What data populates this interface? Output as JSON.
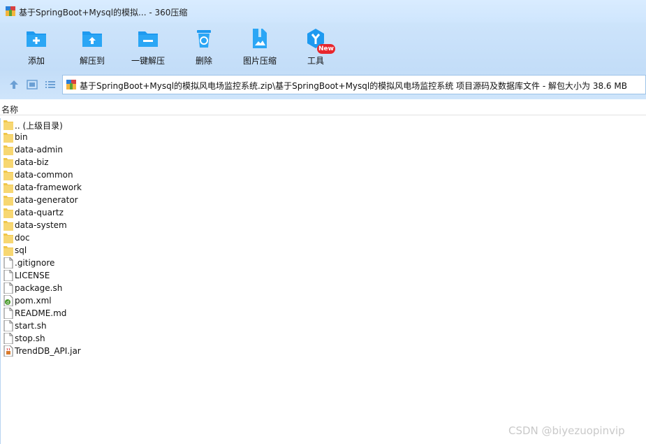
{
  "window": {
    "title": "基于SpringBoot+Mysql的模拟... - 360压缩"
  },
  "toolbar": {
    "items": [
      {
        "label": "添加",
        "icon": "add-icon"
      },
      {
        "label": "解压到",
        "icon": "extract-to-icon"
      },
      {
        "label": "一键解压",
        "icon": "one-click-extract-icon"
      },
      {
        "label": "删除",
        "icon": "delete-icon"
      },
      {
        "label": "图片压缩",
        "icon": "image-compress-icon"
      },
      {
        "label": "工具",
        "icon": "tools-icon"
      }
    ],
    "badge": "New"
  },
  "address": {
    "path": "基于SpringBoot+Mysql的模拟风电场监控系统.zip\\基于SpringBoot+Mysql的模拟风电场监控系统 项目源码及数据库文件 - 解包大小为 38.6 MB"
  },
  "list": {
    "column_name": "名称",
    "items": [
      {
        "name": ".. (上级目录)",
        "type": "folder"
      },
      {
        "name": "bin",
        "type": "folder"
      },
      {
        "name": "data-admin",
        "type": "folder"
      },
      {
        "name": "data-biz",
        "type": "folder"
      },
      {
        "name": "data-common",
        "type": "folder"
      },
      {
        "name": "data-framework",
        "type": "folder"
      },
      {
        "name": "data-generator",
        "type": "folder"
      },
      {
        "name": "data-quartz",
        "type": "folder"
      },
      {
        "name": "data-system",
        "type": "folder"
      },
      {
        "name": "doc",
        "type": "folder"
      },
      {
        "name": "sql",
        "type": "folder"
      },
      {
        "name": ".gitignore",
        "type": "file"
      },
      {
        "name": "LICENSE",
        "type": "file"
      },
      {
        "name": "package.sh",
        "type": "file"
      },
      {
        "name": "pom.xml",
        "type": "xml"
      },
      {
        "name": "README.md",
        "type": "file"
      },
      {
        "name": "start.sh",
        "type": "file"
      },
      {
        "name": "stop.sh",
        "type": "file"
      },
      {
        "name": "TrendDB_API.jar",
        "type": "jar"
      }
    ]
  },
  "watermark": "CSDN @biyezuopinvip",
  "colors": {
    "accent": "#1e9af0",
    "toolbar_bg": "#c8e0fa",
    "folder": "#f7d772",
    "badge": "#e8262d"
  }
}
